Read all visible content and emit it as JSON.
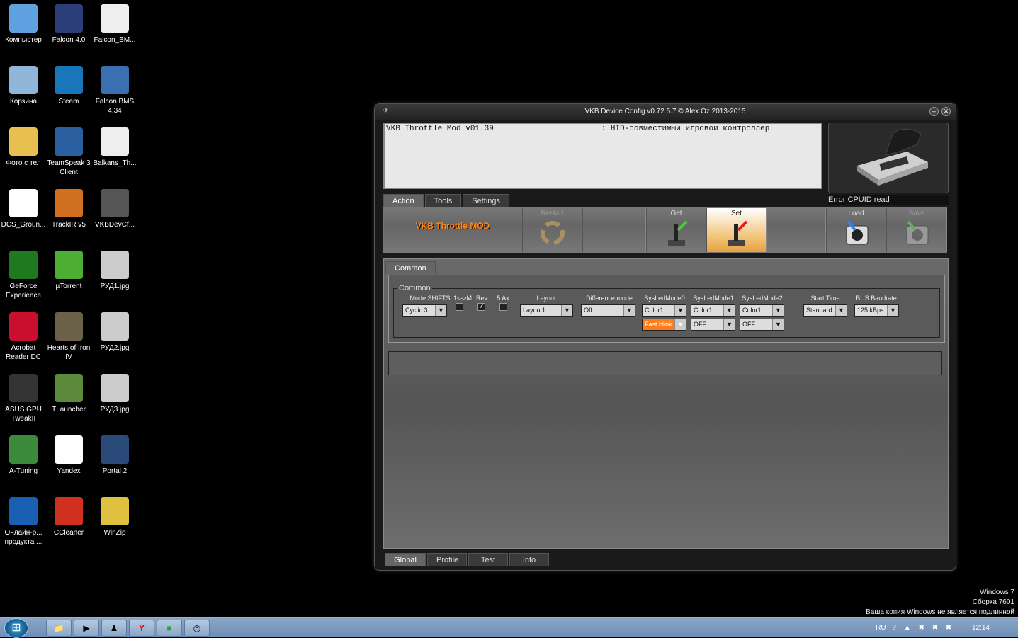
{
  "desktop": {
    "icons": [
      {
        "label": "Компьютер",
        "icon": "computer-icon",
        "color": "#5fa0e0"
      },
      {
        "label": "Falcon 4.0",
        "icon": "falcon-icon",
        "color": "#2b3e7a"
      },
      {
        "label": "Falcon_BM...",
        "icon": "archive-icon",
        "color": "#eeeeee"
      },
      {
        "label": "Корзина",
        "icon": "recycle-bin-icon",
        "color": "#8fb6d8"
      },
      {
        "label": "Steam",
        "icon": "steam-icon",
        "color": "#1b75bb"
      },
      {
        "label": "Falcon BMS 4.34",
        "icon": "falcon-bms-icon",
        "color": "#3a6fb0"
      },
      {
        "label": "Фото с тел",
        "icon": "folder-icon",
        "color": "#e8c050"
      },
      {
        "label": "TeamSpeak 3 Client",
        "icon": "teamspeak-icon",
        "color": "#2a5fa0"
      },
      {
        "label": "Balkans_Th...",
        "icon": "archive-icon",
        "color": "#eeeeee"
      },
      {
        "label": "DCS_Groun...",
        "icon": "pdf-icon",
        "color": "#ffffff"
      },
      {
        "label": "TrackIR v5",
        "icon": "trackir-icon",
        "color": "#d07020"
      },
      {
        "label": "VKBDevCf...",
        "icon": "joystick-icon",
        "color": "#555555"
      },
      {
        "label": "GeForce Experience",
        "icon": "geforce-icon",
        "color": "#1e7a1e"
      },
      {
        "label": "µTorrent",
        "icon": "utorrent-icon",
        "color": "#4cae33"
      },
      {
        "label": "РУД1.jpg",
        "icon": "image-file-icon",
        "color": "#cccccc"
      },
      {
        "label": "Acrobat Reader DC",
        "icon": "acrobat-icon",
        "color": "#c8102e"
      },
      {
        "label": "Hearts of Iron IV",
        "icon": "hoi-icon",
        "color": "#6b6048"
      },
      {
        "label": "РУД2.jpg",
        "icon": "image-file-icon",
        "color": "#cccccc"
      },
      {
        "label": "ASUS GPU TweakII",
        "icon": "gpu-tweak-icon",
        "color": "#333333"
      },
      {
        "label": "TLauncher",
        "icon": "minecraft-icon",
        "color": "#5d8a3a"
      },
      {
        "label": "РУД3.jpg",
        "icon": "image-file-icon",
        "color": "#cccccc"
      },
      {
        "label": "A-Tuning",
        "icon": "a-tuning-icon",
        "color": "#3c8a3c"
      },
      {
        "label": "Yandex",
        "icon": "yandex-icon",
        "color": "#ffffff"
      },
      {
        "label": "Portal 2",
        "icon": "portal-icon",
        "color": "#2a4a7a"
      },
      {
        "label": "Онлайн-р... продукта ...",
        "icon": "asus-icon",
        "color": "#1a5fb4"
      },
      {
        "label": "CCleaner",
        "icon": "ccleaner-icon",
        "color": "#d03020"
      },
      {
        "label": "WinZip",
        "icon": "winzip-icon",
        "color": "#e0c040"
      }
    ]
  },
  "window": {
    "title": "VKB Device Config v0.72.5.7 © Alex Oz 2013-2015",
    "device_name": "VKB Throttle Mod v01.39",
    "device_type": ": HID-совместимый игровой контроллер",
    "status": "Error CPUID read",
    "top_tabs": [
      "Action",
      "Tools",
      "Settings"
    ],
    "model_label": "VKB Throttle MOD",
    "actions": {
      "restart": "Restart",
      "get": "Get",
      "set": "Set",
      "load": "Load",
      "save": "Save"
    },
    "inner_tab": "Common",
    "group_legend": "Common",
    "columns": {
      "mode_shifts": "Mode SHIFTS",
      "one_m": "1<->M",
      "rev": "Rev",
      "five_ax": "5 Ax",
      "layout": "Layout",
      "difference_mode": "Difference mode",
      "sysled0": "SysLedMode0",
      "sysled1": "SysLedMode1",
      "sysled2": "SysLedMode2",
      "start_time": "Start Time",
      "bus_baudrate": "BUS Baudrate"
    },
    "values": {
      "mode_shifts": "Cyclic 3",
      "layout": "Layout1",
      "difference_mode": "Off",
      "sysled0_a": "Color1",
      "sysled0_b": "Fast blink",
      "sysled1_a": "Color1",
      "sysled1_b": "OFF",
      "sysled2_a": "Color1",
      "sysled2_b": "OFF",
      "start_time": "Standard",
      "bus_baudrate": "125 kBps"
    },
    "checks": {
      "one_m": false,
      "rev": true,
      "five_ax": false
    },
    "bottom_tabs": [
      "Global",
      "Profile",
      "Test",
      "Info"
    ],
    "accent": "#ff7d18"
  },
  "taskbar": {
    "lang": "RU",
    "time": "12:14"
  },
  "watermark": {
    "line1": "Windows 7",
    "line2": "Сборка 7601",
    "line3": "Ваша копия Windows не является подлинной"
  }
}
